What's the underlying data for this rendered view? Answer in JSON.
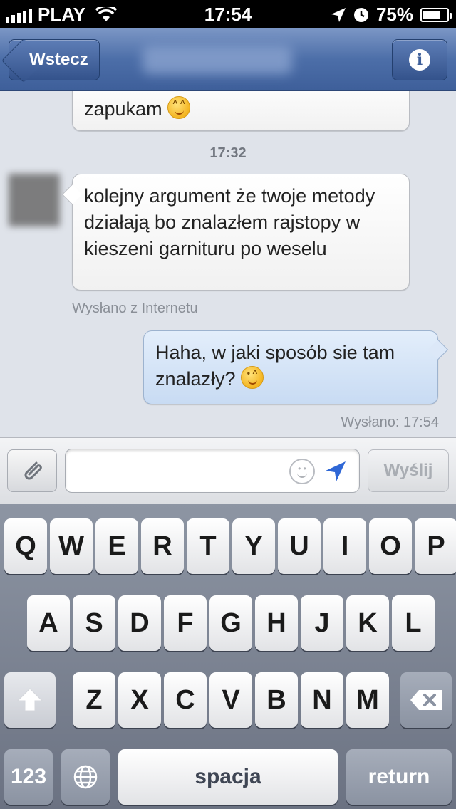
{
  "status_bar": {
    "carrier": "PLAY",
    "time": "17:54",
    "battery": "75%",
    "battery_level": 0.75
  },
  "navbar": {
    "back_label": "Wstecz"
  },
  "chat": {
    "partial_message": "zapukam",
    "timestamp": "17:32",
    "incoming_message": "kolejny argument że twoje metody działają bo znalazłem rajstopy w kieszeni garnituru po weselu",
    "incoming_meta": "Wysłano z Internetu",
    "outgoing_message": "Haha, w jaki sposób sie tam znalazły?",
    "outgoing_meta": "Wysłano: 17:54"
  },
  "input": {
    "value": "",
    "send_label": "Wyślij"
  },
  "keyboard": {
    "row1": [
      "Q",
      "W",
      "E",
      "R",
      "T",
      "Y",
      "U",
      "I",
      "O",
      "P"
    ],
    "row2": [
      "A",
      "S",
      "D",
      "F",
      "G",
      "H",
      "J",
      "K",
      "L"
    ],
    "row3": [
      "Z",
      "X",
      "C",
      "V",
      "B",
      "N",
      "M"
    ],
    "numbers_label": "123",
    "space_label": "spacja",
    "return_label": "return"
  },
  "icons": [
    "signal-icon",
    "wifi-icon",
    "location-icon",
    "clock-icon",
    "battery-icon",
    "info-icon",
    "emoji-smile-icon",
    "emoji-wink-icon",
    "paperclip-icon",
    "smiley-icon",
    "location-arrow-icon",
    "shift-icon",
    "globe-icon",
    "backspace-icon"
  ]
}
